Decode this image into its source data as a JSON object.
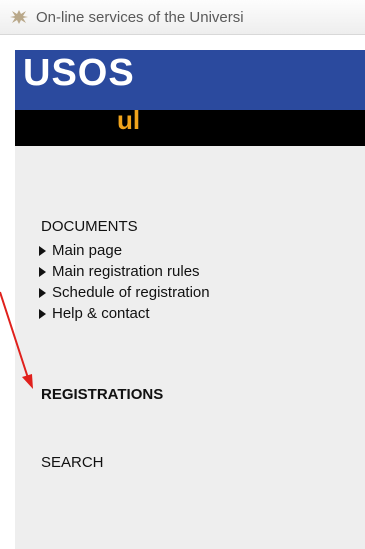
{
  "tab": {
    "title": "On-line services of the Universi"
  },
  "logo": {
    "main": "USOS",
    "sub": "ul"
  },
  "sidebar": {
    "documents_title": "DOCUMENTS",
    "items": [
      {
        "label": "Main page"
      },
      {
        "label": "Main registration rules"
      },
      {
        "label": "Schedule of registration"
      },
      {
        "label": "Help & contact"
      }
    ],
    "registrations_title": "REGISTRATIONS",
    "search_title": "SEARCH"
  },
  "colors": {
    "logo_bar": "#2b4a9e",
    "sub_logo": "#f0a31c",
    "sidebar_bg": "#eeeeee",
    "annotation": "#e0201c"
  }
}
